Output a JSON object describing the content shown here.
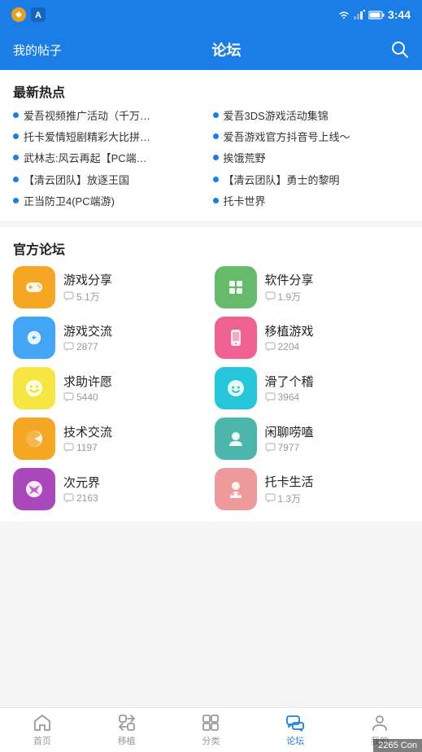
{
  "statusBar": {
    "time": "3:44"
  },
  "header": {
    "leftLabel": "我的帖子",
    "title": "论坛",
    "searchLabel": "搜索"
  },
  "hotSection": {
    "title": "最新热点",
    "items": [
      "爱吾视频推广活动（千万…",
      "爱吾3DS游戏活动集锦",
      "托卡爱情短剧精彩大比拼…",
      "爱吾游戏官方抖音号上线～",
      "武林志:风云再起【PC端…",
      "挨饿荒野",
      "【清云团队】放逐王国",
      "【清云团队】勇士的黎明",
      "正当防卫4(PC端游)",
      "托卡世界"
    ]
  },
  "forumSection": {
    "title": "官方论坛",
    "items": [
      {
        "name": "游戏分享",
        "count": "5.1万",
        "colorClass": "icon-orange"
      },
      {
        "name": "软件分享",
        "count": "1.9万",
        "colorClass": "icon-green"
      },
      {
        "name": "游戏交流",
        "count": "2877",
        "colorClass": "icon-light-blue"
      },
      {
        "name": "移植游戏",
        "count": "2204",
        "colorClass": "icon-pink"
      },
      {
        "name": "求助许愿",
        "count": "5440",
        "colorClass": "icon-yellow"
      },
      {
        "name": "滑了个稽",
        "count": "3964",
        "colorClass": "icon-teal"
      },
      {
        "name": "技术交流",
        "count": "1197",
        "colorClass": "icon-orange"
      },
      {
        "name": "闲聊唠嗑",
        "count": "7977",
        "colorClass": "icon-cyan"
      },
      {
        "name": "次元界",
        "count": "2163",
        "colorClass": "icon-purple"
      },
      {
        "name": "托卡生活",
        "count": "1.3万",
        "colorClass": "icon-coral"
      }
    ]
  },
  "bottomNav": {
    "items": [
      {
        "label": "首页",
        "icon": "home"
      },
      {
        "label": "移植",
        "icon": "transfer"
      },
      {
        "label": "分类",
        "icon": "category"
      },
      {
        "label": "论坛",
        "icon": "forum",
        "active": true
      },
      {
        "label": "我的",
        "icon": "profile"
      }
    ]
  },
  "watermark": "2265 Con"
}
